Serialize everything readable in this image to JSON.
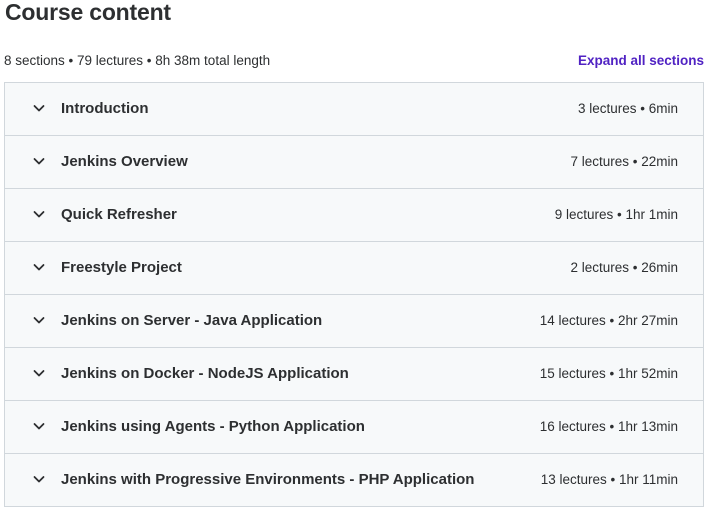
{
  "header": {
    "title": "Course content",
    "summary": "8 sections • 79 lectures • 8h 38m total length",
    "expand_all_label": "Expand all sections"
  },
  "colors": {
    "accent": "#5022c3",
    "text": "#2d2f31",
    "section_bg": "#f7f9fa",
    "border": "#d1d7dc"
  },
  "sections": [
    {
      "title": "Introduction",
      "meta": "3 lectures • 6min",
      "icon": "chevron-down-icon"
    },
    {
      "title": "Jenkins Overview",
      "meta": "7 lectures • 22min",
      "icon": "chevron-down-icon"
    },
    {
      "title": "Quick Refresher",
      "meta": "9 lectures • 1hr 1min",
      "icon": "chevron-down-icon"
    },
    {
      "title": "Freestyle Project",
      "meta": "2 lectures • 26min",
      "icon": "chevron-down-icon"
    },
    {
      "title": "Jenkins on Server - Java Application",
      "meta": "14 lectures • 2hr 27min",
      "icon": "chevron-down-icon"
    },
    {
      "title": "Jenkins on Docker - NodeJS Application",
      "meta": "15 lectures • 1hr 52min",
      "icon": "chevron-down-icon"
    },
    {
      "title": "Jenkins using Agents - Python Application",
      "meta": "16 lectures • 1hr 13min",
      "icon": "chevron-down-icon"
    },
    {
      "title": "Jenkins with Progressive Environments - PHP Application",
      "meta": "13 lectures • 1hr 11min",
      "icon": "chevron-down-icon"
    }
  ]
}
